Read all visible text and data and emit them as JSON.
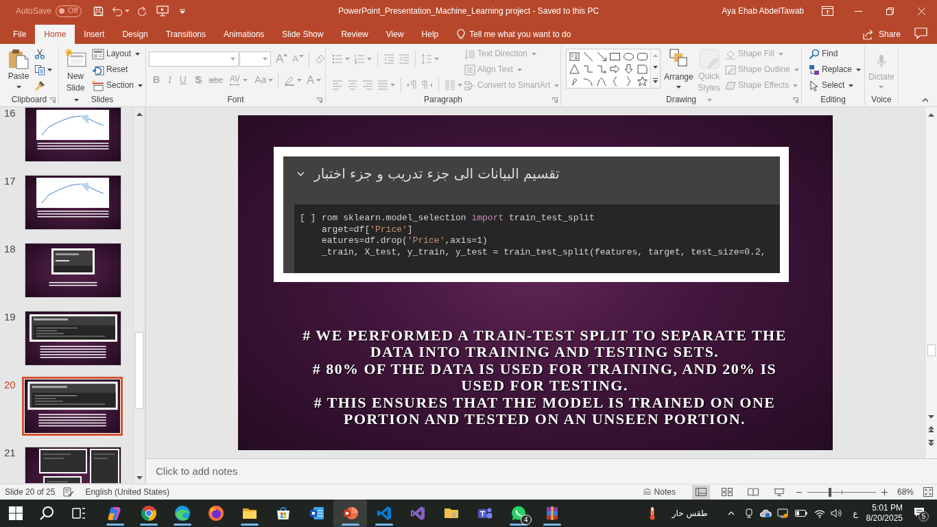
{
  "title_bar": {
    "autosave": {
      "label": "AutoSave",
      "on": false,
      "state_text": "Off"
    },
    "title": "PowerPoint_Presentation_Machine_Learning project - Saved to this PC",
    "user": "Aya Ehab AbdelTawab"
  },
  "tabs": [
    {
      "label": "File",
      "selected": false
    },
    {
      "label": "Home",
      "selected": true
    },
    {
      "label": "Insert",
      "selected": false
    },
    {
      "label": "Design",
      "selected": false
    },
    {
      "label": "Transitions",
      "selected": false
    },
    {
      "label": "Animations",
      "selected": false
    },
    {
      "label": "Slide Show",
      "selected": false
    },
    {
      "label": "Review",
      "selected": false
    },
    {
      "label": "View",
      "selected": false
    },
    {
      "label": "Help",
      "selected": false
    }
  ],
  "tell_me": "Tell me what you want to do",
  "share": "Share",
  "ribbon": {
    "clipboard": {
      "label": "Clipboard",
      "paste": "Paste"
    },
    "slides": {
      "label": "Slides",
      "buttons": [
        "New Slide",
        "Layout",
        "Reset",
        "Section"
      ]
    },
    "font": {
      "label": "Font",
      "disabled": true,
      "keys": [
        {
          "label": "A",
          "kind": "grow"
        },
        {
          "label": "A",
          "kind": "shrink"
        },
        {
          "label": "B",
          "kind": "bold"
        },
        {
          "label": "I",
          "kind": "italic"
        },
        {
          "label": "U",
          "kind": "underline"
        },
        {
          "label": "S",
          "kind": "shadow"
        },
        {
          "label": "abc",
          "kind": "strike"
        },
        {
          "label": "AV",
          "kind": "spacing"
        },
        {
          "label": "Aa",
          "kind": "case"
        },
        {
          "label": "A",
          "kind": "color"
        }
      ]
    },
    "paragraph": {
      "label": "Paragraph",
      "disabled": true,
      "buttons": [
        "Text Direction",
        "Align Text",
        "Convert to SmartArt"
      ]
    },
    "drawing": {
      "label": "Drawing",
      "buttons": [
        {
          "label": "Arrange",
          "disabled": false
        },
        {
          "label": "Quick Styles",
          "disabled": true
        },
        {
          "label": "Shape Fill",
          "disabled": true
        },
        {
          "label": "Shape Outline",
          "disabled": true
        },
        {
          "label": "Shape Effects",
          "disabled": true
        }
      ]
    },
    "editing": {
      "label": "Editing",
      "buttons": [
        "Find",
        "Replace",
        "Select"
      ]
    },
    "voice": {
      "label": "Voice",
      "buttons": [
        {
          "label": "Dictate",
          "disabled": true
        }
      ]
    }
  },
  "slides": [
    {
      "number": "16",
      "kind": "chart",
      "selected": false
    },
    {
      "number": "17",
      "kind": "chart",
      "selected": false
    },
    {
      "number": "18",
      "kind": "notebook",
      "selected": false
    },
    {
      "number": "19",
      "kind": "code",
      "selected": false
    },
    {
      "number": "20",
      "kind": "code",
      "selected": true
    },
    {
      "number": "21",
      "kind": "collage",
      "selected": false
    }
  ],
  "slide": {
    "notebook": {
      "heading": "تقسيم البيانات الى جزء تدريب و جزء اختبار",
      "run_marker": "[ ]",
      "code": [
        [
          {
            "text": "rom sklearn.model_selection ",
            "kind": "plain"
          },
          {
            "text": "import",
            "kind": "keyword"
          },
          {
            "text": " train_test_split",
            "kind": "plain"
          }
        ],
        [
          {
            "text": "arget=df[",
            "kind": "plain"
          },
          {
            "text": "'Price'",
            "kind": "string"
          },
          {
            "text": "]",
            "kind": "plain"
          }
        ],
        [
          {
            "text": "eatures=df.drop(",
            "kind": "plain"
          },
          {
            "text": "'Price'",
            "kind": "string"
          },
          {
            "text": ",axis=1)",
            "kind": "plain"
          }
        ],
        [
          {
            "text": "_train, X_test, y_train, y_test = train_test_split(features, target, test_size=0.2,",
            "kind": "plain"
          }
        ]
      ]
    },
    "body": [
      "# WE PERFORMED A TRAIN-TEST SPLIT TO SEPARATE THE DATA INTO TRAINING AND TESTING SETS.",
      "# 80% OF THE DATA IS USED FOR TRAINING, AND 20% IS USED FOR TESTING.",
      "# THIS ENSURES THAT THE MODEL IS TRAINED ON ONE PORTION AND TESTED ON AN UNSEEN PORTION."
    ]
  },
  "notes": {
    "placeholder": "Click to add notes"
  },
  "status_bar": {
    "slide_info": "Slide 20 of 25",
    "language": "English (United States)",
    "notes": "Notes",
    "views": [
      {
        "selected": true
      },
      {
        "selected": false
      },
      {
        "selected": false
      },
      {
        "selected": false
      }
    ],
    "zoom": {
      "level": 0.33,
      "reading": "68%"
    }
  },
  "taskbar": {
    "apps": [
      {
        "running": true,
        "active": false
      },
      {
        "running": true,
        "active": false
      },
      {
        "running": true,
        "active": false
      },
      {
        "running": false,
        "active": false
      },
      {
        "running": true,
        "active": false
      },
      {
        "running": false,
        "active": false
      },
      {
        "running": false,
        "active": false
      },
      {
        "running": true,
        "active": true
      },
      {
        "running": true,
        "active": false
      },
      {
        "running": false,
        "active": false
      },
      {
        "running": false,
        "active": false
      },
      {
        "running": false,
        "active": false
      },
      {
        "running": true,
        "active": false,
        "badge": "4"
      },
      {
        "running": true,
        "active": false
      }
    ],
    "weather": "طقس حار",
    "input_language": "ع",
    "time": "5:01 PM",
    "date": "8/20/2025",
    "notifications": "5"
  }
}
